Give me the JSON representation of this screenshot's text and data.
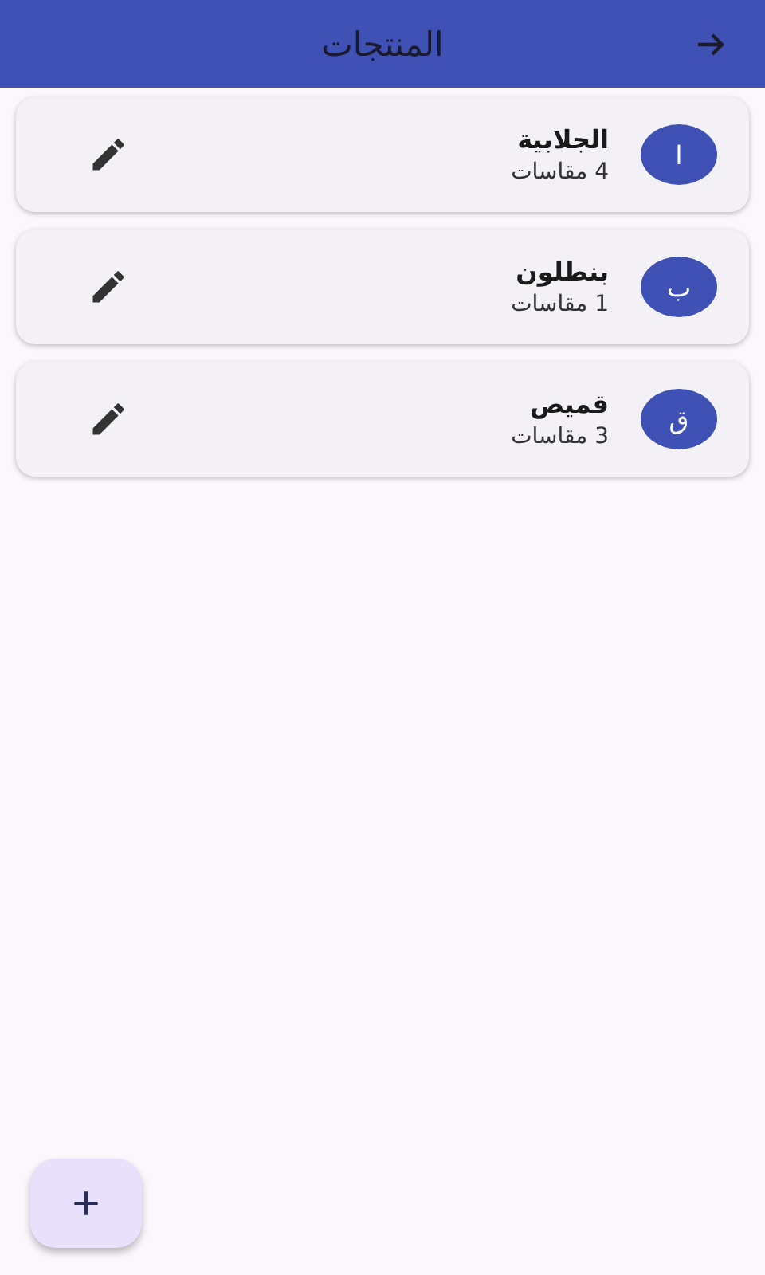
{
  "app_bar": {
    "title": "المنتجات"
  },
  "products": [
    {
      "initial": "ا",
      "name": "الجلابية",
      "sizes": "4 مقاسات"
    },
    {
      "initial": "ب",
      "name": "بنطلون",
      "sizes": "1 مقاسات"
    },
    {
      "initial": "ق",
      "name": "قميص",
      "sizes": "3 مقاسات"
    }
  ]
}
